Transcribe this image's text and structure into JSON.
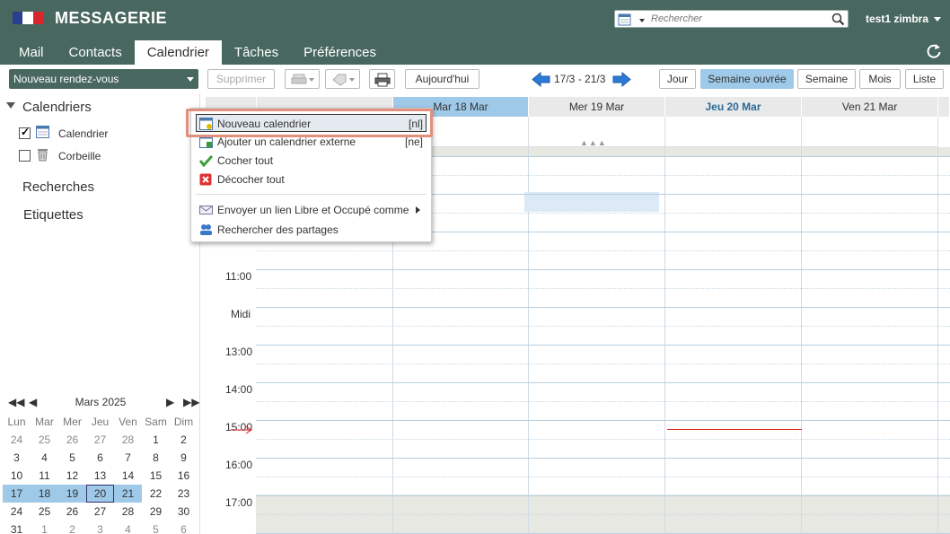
{
  "header": {
    "app_name": "MESSAGERIE",
    "search_placeholder": "Rechercher",
    "user": "test1 zimbra"
  },
  "tabs": [
    {
      "label": "Mail"
    },
    {
      "label": "Contacts"
    },
    {
      "label": "Calendrier",
      "active": true
    },
    {
      "label": "Tâches"
    },
    {
      "label": "Préférences"
    }
  ],
  "toolbar": {
    "new_appointment": "Nouveau rendez-vous",
    "delete": "Supprimer",
    "today": "Aujourd'hui",
    "date_range": "17/3 - 21/3",
    "views": [
      "Jour",
      "Semaine ouvrée",
      "Semaine",
      "Mois",
      "Liste"
    ],
    "active_view": "Semaine ouvrée"
  },
  "left": {
    "calendars_header": "Calendriers",
    "calendars": [
      {
        "name": "Calendrier",
        "checked": true
      },
      {
        "name": "Corbeille",
        "checked": false
      }
    ],
    "searches": "Recherches",
    "tags": "Etiquettes"
  },
  "minical": {
    "month": "Mars 2025",
    "weekdays": [
      "Lun",
      "Mar",
      "Mer",
      "Jeu",
      "Ven",
      "Sam",
      "Dim"
    ],
    "weeks": [
      [
        "24",
        "25",
        "26",
        "27",
        "28",
        "1",
        "2"
      ],
      [
        "3",
        "4",
        "5",
        "6",
        "7",
        "8",
        "9"
      ],
      [
        "10",
        "11",
        "12",
        "13",
        "14",
        "15",
        "16"
      ],
      [
        "17",
        "18",
        "19",
        "20",
        "21",
        "22",
        "23"
      ],
      [
        "24",
        "25",
        "26",
        "27",
        "28",
        "29",
        "30"
      ],
      [
        "31",
        "1",
        "2",
        "3",
        "4",
        "5",
        "6"
      ]
    ],
    "today": "20"
  },
  "calendar": {
    "days": [
      "Mar 18 Mar",
      "Mer 19 Mar",
      "Jeu 20 Mar",
      "Ven 21 Mar"
    ],
    "hours": [
      "11:00",
      "Midi",
      "13:00",
      "14:00",
      "15:00",
      "16:00",
      "17:00"
    ]
  },
  "menu": {
    "items": [
      {
        "label": "Nouveau calendrier",
        "shortcut": "[nl]"
      },
      {
        "label": "Ajouter un calendrier externe",
        "shortcut": "[ne]"
      },
      {
        "label": "Cocher tout",
        "shortcut": ""
      },
      {
        "label": "Décocher tout",
        "shortcut": ""
      },
      {
        "label": "Envoyer un lien Libre et Occupé comme",
        "shortcut": ""
      },
      {
        "label": "Rechercher des partages",
        "shortcut": ""
      }
    ]
  }
}
